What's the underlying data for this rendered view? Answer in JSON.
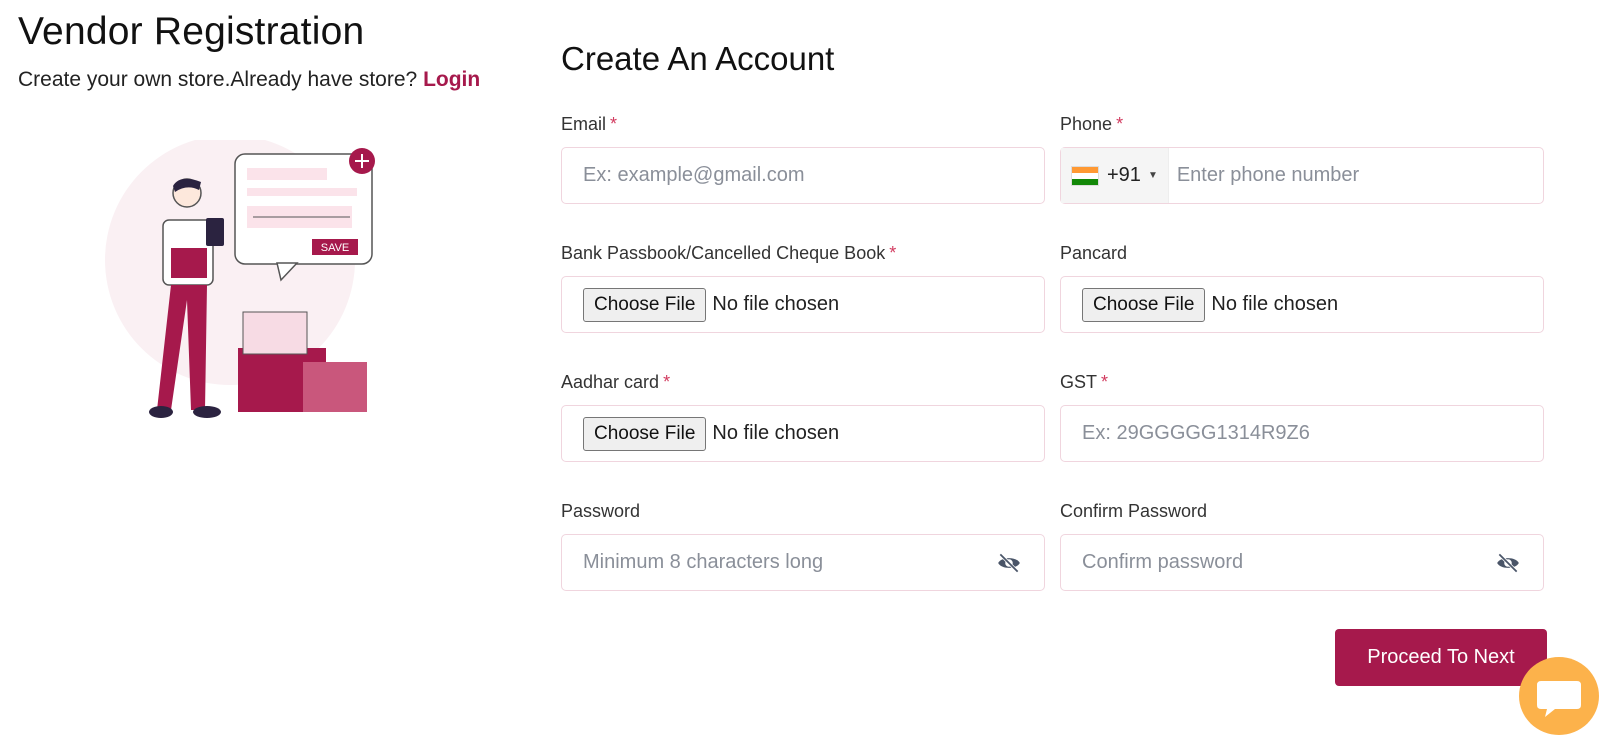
{
  "header": {
    "title": "Vendor Registration",
    "subtitle": "Create your own store.Already have store?",
    "login_link": "Login"
  },
  "illustration": {
    "save_label": "SAVE"
  },
  "form": {
    "title": "Create An Account",
    "email": {
      "label": "Email",
      "required": "*",
      "placeholder": "Ex: example@gmail.com"
    },
    "phone": {
      "label": "Phone",
      "required": "*",
      "country_code": "+91",
      "placeholder": "Enter phone number"
    },
    "bank": {
      "label": "Bank Passbook/Cancelled Cheque Book",
      "required": "*",
      "button": "Choose File",
      "status": "No file chosen"
    },
    "pancard": {
      "label": "Pancard",
      "button": "Choose File",
      "status": "No file chosen"
    },
    "aadhar": {
      "label": "Aadhar card",
      "required": "*",
      "button": "Choose File",
      "status": "No file chosen"
    },
    "gst": {
      "label": "GST",
      "required": "*",
      "placeholder": "Ex: 29GGGGG1314R9Z6"
    },
    "password": {
      "label": "Password",
      "placeholder": "Minimum 8 characters long"
    },
    "confirm_password": {
      "label": "Confirm Password",
      "placeholder": "Confirm password"
    },
    "submit_label": "Proceed To Next"
  },
  "colors": {
    "brand": "#a6194c",
    "required": "#d23b5f",
    "chat": "#fcb24b"
  },
  "icons": {
    "password_toggle": "eye-slash-icon",
    "chat": "chat-bubble-icon",
    "flag": "india-flag-icon"
  }
}
